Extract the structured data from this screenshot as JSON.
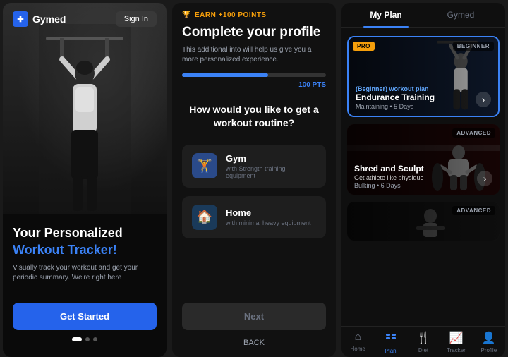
{
  "panel1": {
    "logo_text": "Gymed",
    "sign_in_label": "Sign In",
    "hero_title_line1": "Your Personalized",
    "hero_title_line2": "Workout Tracker!",
    "hero_subtitle": "Visually track your workout and get your periodic summary. We're right here",
    "cta_label": "Get Started",
    "dots": [
      "active",
      "inactive",
      "inactive"
    ]
  },
  "panel2": {
    "earn_label": "EARN +100 POINTS",
    "title": "Complete your profile",
    "subtitle": "This additional into will help us give you a more personalized experience.",
    "progress_pct": 60,
    "pts_label": "100 PTS",
    "question": "How would you like to get a workout routine?",
    "options": [
      {
        "icon": "🏋️",
        "label": "Gym",
        "desc": "with Strength training equipment"
      },
      {
        "icon": "🏠",
        "label": "Home",
        "desc": "with minimal heavy equipment"
      }
    ],
    "next_label": "Next",
    "back_label": "BACK"
  },
  "panel3": {
    "tabs": [
      {
        "label": "My Plan",
        "active": true
      },
      {
        "label": "Gymed",
        "active": false
      }
    ],
    "plans": [
      {
        "badge_left": "PRO",
        "badge_right": "BEGINNER",
        "subtitle": "(Beginner) workout plan",
        "name": "Endurance Training",
        "meta": "Maintaining • 5 Days",
        "featured": true
      },
      {
        "badge_left": "",
        "badge_right": "ADVANCED",
        "subtitle": "",
        "name": "Shred and Sculpt",
        "meta": "Bulking • 6 Days",
        "desc": "Get athlete like physique",
        "featured": false
      },
      {
        "badge_left": "",
        "badge_right": "ADVANCED",
        "subtitle": "",
        "name": "",
        "meta": "",
        "featured": false
      }
    ],
    "nav": [
      {
        "icon": "⌂",
        "label": "Home",
        "active": false
      },
      {
        "icon": "◫",
        "label": "Plan",
        "active": true
      },
      {
        "icon": "🍴",
        "label": "Diet",
        "active": false
      },
      {
        "icon": "📈",
        "label": "Tracker",
        "active": false
      },
      {
        "icon": "👤",
        "label": "Profile",
        "active": false
      }
    ]
  }
}
